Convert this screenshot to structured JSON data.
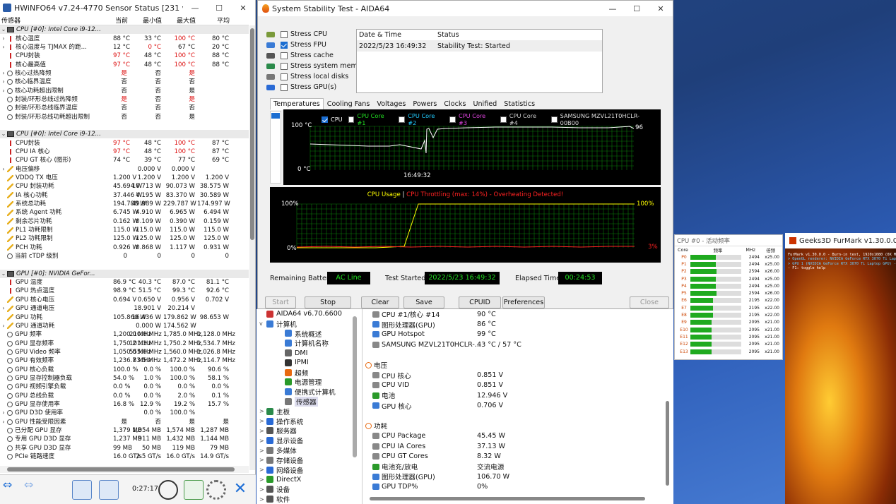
{
  "hwinfo": {
    "title": "HWiNFO64 v7.24-4770 Sensor Status [231 values hidd...",
    "columns": [
      "传感器",
      "当前",
      "最小值",
      "最大值",
      "平均"
    ],
    "rows": [
      {
        "k": "grp",
        "name": "CPU [#0]: Intel Core i9-12..."
      },
      {
        "k": "therm",
        "ex": ">",
        "name": "核心温度",
        "v": [
          "88 °C",
          "33 °C",
          "100 °C",
          "80 °C"
        ],
        "red": [
          2
        ]
      },
      {
        "k": "therm",
        "ex": ">",
        "name": "核心温度与 TJMAX 的距...",
        "v": [
          "12 °C",
          "0 °C",
          "67 °C",
          "20 °C"
        ],
        "red": [
          1
        ]
      },
      {
        "k": "therm",
        "name": "CPU封装",
        "v": [
          "97 °C",
          "48 °C",
          "100 °C",
          "88 °C"
        ],
        "red": [
          0,
          2
        ]
      },
      {
        "k": "therm",
        "name": "核心最高值",
        "v": [
          "97 °C",
          "48 °C",
          "100 °C",
          "88 °C"
        ],
        "red": [
          0,
          2
        ]
      },
      {
        "k": "circ",
        "ex": ">",
        "name": "核心过热降频",
        "v": [
          "是",
          "否",
          "是",
          ""
        ],
        "red": [
          0,
          2
        ]
      },
      {
        "k": "circ",
        "ex": ">",
        "name": "核心临界温度",
        "v": [
          "否",
          "否",
          "否",
          ""
        ]
      },
      {
        "k": "circ",
        "ex": ">",
        "name": "核心功耗超出限制",
        "v": [
          "否",
          "否",
          "是",
          ""
        ]
      },
      {
        "k": "circ",
        "name": "封装/环形总线过热降频",
        "v": [
          "是",
          "否",
          "是",
          ""
        ],
        "red": [
          0,
          2
        ]
      },
      {
        "k": "circ",
        "name": "封装/环形总线临界温度",
        "v": [
          "否",
          "否",
          "否",
          ""
        ]
      },
      {
        "k": "circ",
        "name": "封装/环形总线功耗超出限制",
        "v": [
          "否",
          "否",
          "是",
          ""
        ]
      },
      {
        "k": "blank",
        "name": ""
      },
      {
        "k": "grp",
        "name": "CPU [#0]: Intel Core i9-12..."
      },
      {
        "k": "therm",
        "name": "CPU封装",
        "v": [
          "97 °C",
          "48 °C",
          "100 °C",
          "87 °C"
        ],
        "red": [
          0,
          2
        ]
      },
      {
        "k": "therm",
        "name": "CPU IA 核心",
        "v": [
          "97 °C",
          "48 °C",
          "100 °C",
          "87 °C"
        ],
        "red": [
          0,
          2
        ]
      },
      {
        "k": "therm",
        "name": "CPU GT 核心 (图形)",
        "v": [
          "74 °C",
          "39 °C",
          "77 °C",
          "69 °C"
        ]
      },
      {
        "k": "bolt",
        "ex": ">",
        "name": "电压偏移",
        "v": [
          "",
          "0.000 V",
          "0.000 V",
          ""
        ]
      },
      {
        "k": "bolt",
        "name": "VDDQ TX 电压",
        "v": [
          "1.200 V",
          "1.200 V",
          "1.200 V",
          "1.200 V"
        ]
      },
      {
        "k": "bolt",
        "name": "CPU 封装功耗",
        "v": [
          "45.694 W",
          "10.713 W",
          "90.073 W",
          "38.575 W"
        ]
      },
      {
        "k": "bolt",
        "name": "IA 核心功耗",
        "v": [
          "37.446 W",
          "4.195 W",
          "83.370 W",
          "30.589 W"
        ]
      },
      {
        "k": "bolt",
        "name": "系统总功耗",
        "v": [
          "194.788 W",
          "49.989 W",
          "229.787 W",
          "174.997 W"
        ]
      },
      {
        "k": "bolt",
        "name": "系统 Agent 功耗",
        "v": [
          "6.745 W",
          "4.910 W",
          "6.965 W",
          "6.494 W"
        ]
      },
      {
        "k": "bolt",
        "name": "剩余芯片功耗",
        "v": [
          "0.162 W",
          "0.109 W",
          "0.390 W",
          "0.159 W"
        ]
      },
      {
        "k": "bolt",
        "name": "PL1 功耗限制",
        "v": [
          "115.0 W",
          "115.0 W",
          "115.0 W",
          "115.0 W"
        ]
      },
      {
        "k": "bolt",
        "name": "PL2 功耗限制",
        "v": [
          "125.0 W",
          "125.0 W",
          "125.0 W",
          "125.0 W"
        ]
      },
      {
        "k": "bolt",
        "name": "PCH 功耗",
        "v": [
          "0.926 W",
          "0.868 W",
          "1.117 W",
          "0.931 W"
        ]
      },
      {
        "k": "circ",
        "name": "当前 cTDP 级别",
        "v": [
          "0",
          "0",
          "0",
          "0"
        ]
      },
      {
        "k": "blank",
        "name": ""
      },
      {
        "k": "grp",
        "name": "GPU [#0]: NVIDIA GeFor..."
      },
      {
        "k": "therm",
        "name": "GPU 温度",
        "v": [
          "86.9 °C",
          "40.3 °C",
          "87.0 °C",
          "81.1 °C"
        ]
      },
      {
        "k": "therm",
        "name": "GPU 热点温度",
        "v": [
          "98.9 °C",
          "51.5 °C",
          "99.3 °C",
          "92.6 °C"
        ]
      },
      {
        "k": "bolt",
        "name": "GPU 核心电压",
        "v": [
          "0.694 V",
          "0.650 V",
          "0.956 V",
          "0.702 V"
        ]
      },
      {
        "k": "bolt",
        "ex": ">",
        "name": "GPU 通道电压",
        "v": [
          "",
          "18.901 V",
          "20.214 V",
          ""
        ]
      },
      {
        "k": "bolt",
        "name": "GPU 功耗",
        "v": [
          "105.860 W",
          "16.436 W",
          "179.862 W",
          "98.653 W"
        ]
      },
      {
        "k": "bolt",
        "ex": ">",
        "name": "GPU 通道功耗",
        "v": [
          "",
          "0.000 W",
          "174.562 W",
          ""
        ]
      },
      {
        "k": "circ",
        "name": "GPU 频率",
        "v": [
          "1,200.0 MHz",
          "210.0 MHz",
          "1,785.0 MHz",
          "1,128.0 MHz"
        ]
      },
      {
        "k": "circ",
        "name": "GPU 显存频率",
        "v": [
          "1,750.2 MHz",
          "101.3 MHz",
          "1,750.2 MHz",
          "1,534.7 MHz"
        ]
      },
      {
        "k": "circ",
        "name": "GPU Video 频率",
        "v": [
          "1,050.0 MHz",
          "555.0 MHz",
          "1,560.0 MHz",
          "1,026.8 MHz"
        ]
      },
      {
        "k": "circ",
        "name": "GPU 有效频率",
        "v": [
          "1,236.7 MHz",
          "83.5 MHz",
          "1,472.2 MHz",
          "1,114.7 MHz"
        ]
      },
      {
        "k": "circ",
        "name": "GPU 核心负载",
        "v": [
          "100.0 %",
          "0.0 %",
          "100.0 %",
          "90.6 %"
        ]
      },
      {
        "k": "circ",
        "name": "GPU 显存控制器负载",
        "v": [
          "54.0 %",
          "1.0 %",
          "100.0 %",
          "58.1 %"
        ]
      },
      {
        "k": "circ",
        "name": "GPU 视频引擎负载",
        "v": [
          "0.0 %",
          "0.0 %",
          "0.0 %",
          "0.0 %"
        ]
      },
      {
        "k": "circ",
        "name": "GPU 总线负载",
        "v": [
          "0.0 %",
          "0.0 %",
          "2.0 %",
          "0.1 %"
        ]
      },
      {
        "k": "circ",
        "name": "GPU 显存使用率",
        "v": [
          "16.8 %",
          "12.9 %",
          "19.2 %",
          "15.7 %"
        ]
      },
      {
        "k": "circ",
        "ex": ">",
        "name": "GPU D3D 使用率",
        "v": [
          "",
          "0.0 %",
          "100.0 %",
          ""
        ]
      },
      {
        "k": "circ",
        "ex": ">",
        "name": "GPU 性能受限因素",
        "v": [
          "是",
          "否",
          "是",
          "是"
        ]
      },
      {
        "k": "circ",
        "name": "已分配 GPU 显存",
        "v": [
          "1,379 MB",
          "1,054 MB",
          "1,574 MB",
          "1,287 MB"
        ]
      },
      {
        "k": "circ",
        "name": "专用 GPU D3D 显存",
        "v": [
          "1,237 MB",
          "911 MB",
          "1,432 MB",
          "1,144 MB"
        ]
      },
      {
        "k": "circ",
        "name": "共享 GPU D3D 显存",
        "v": [
          "99 MB",
          "50 MB",
          "119 MB",
          "79 MB"
        ]
      },
      {
        "k": "circ",
        "name": "PCIe 链路速度",
        "v": [
          "16.0 GT/s",
          "2.5 GT/s",
          "16.0 GT/s",
          "14.9 GT/s"
        ]
      }
    ],
    "timer": "0:27:17"
  },
  "stability": {
    "title": "System Stability Test - AIDA64",
    "checks": [
      {
        "label": "Stress CPU",
        "on": false
      },
      {
        "label": "Stress FPU",
        "on": true
      },
      {
        "label": "Stress cache",
        "on": false
      },
      {
        "label": "Stress system memory",
        "on": false
      },
      {
        "label": "Stress local disks",
        "on": false
      },
      {
        "label": "Stress GPU(s)",
        "on": false
      }
    ],
    "log_headers": [
      "Date & Time",
      "Status"
    ],
    "log_rows": [
      [
        "2022/5/23 16:49:32",
        "Stability Test: Started"
      ]
    ],
    "tabs": [
      "Temperatures",
      "Cooling Fans",
      "Voltages",
      "Powers",
      "Clocks",
      "Unified",
      "Statistics"
    ],
    "temp_legend": [
      {
        "label": "CPU",
        "color": "#ffffff",
        "on": true
      },
      {
        "label": "CPU Core #1",
        "color": "#22dd22",
        "on": false
      },
      {
        "label": "CPU Core #2",
        "color": "#22ccff",
        "on": false
      },
      {
        "label": "CPU Core #3",
        "color": "#dd44dd",
        "on": false
      },
      {
        "label": "CPU Core #4",
        "color": "#cccccc",
        "on": false
      },
      {
        "label": "SAMSUNG MZVL21T0HCLR-00B00",
        "color": "#dddddd",
        "on": false
      }
    ],
    "temp_top": "100 °C",
    "temp_bottom": "0 °C",
    "temp_time": "16:49:32",
    "temp_value": "96",
    "usage_title": "CPU Usage",
    "usage_sep": "|",
    "usage_throttle": "CPU Throttling (max: 14%) - Overheating Detected!",
    "usage_top": "100%",
    "usage_bottom": "0%",
    "usage_right_top": "100%",
    "usage_right_bottom": "3%",
    "remaining_battery_label": "Remaining Battery:",
    "remaining_battery": "AC Line",
    "test_started_label": "Test Started:",
    "test_started": "2022/5/23 16:49:32",
    "elapsed_label": "Elapsed Time:",
    "elapsed": "00:24:53",
    "buttons": {
      "start": "Start",
      "stop": "Stop",
      "clear": "Clear",
      "save": "Save",
      "cpuid": "CPUID",
      "preferences": "Preferences",
      "close": "Close"
    }
  },
  "aida": {
    "tree": [
      {
        "label": "AIDA64 v6.70.6600",
        "lvl": 0,
        "c": "#c33"
      },
      {
        "label": "计算机",
        "lvl": 0,
        "ex": "v",
        "c": "#3a7bd5"
      },
      {
        "label": "系统概述",
        "lvl": 1,
        "c": "#3a7bd5"
      },
      {
        "label": "计算机名称",
        "lvl": 1,
        "c": "#3a7bd5"
      },
      {
        "label": "DMI",
        "lvl": 1,
        "c": "#666"
      },
      {
        "label": "IPMI",
        "lvl": 1,
        "c": "#333"
      },
      {
        "label": "超频",
        "lvl": 1,
        "c": "#e86a10"
      },
      {
        "label": "电源管理",
        "lvl": 1,
        "c": "#2a9a2a"
      },
      {
        "label": "便携式计算机",
        "lvl": 1,
        "c": "#3a7bd5"
      },
      {
        "label": "传感器",
        "lvl": 1,
        "c": "#777",
        "sel": true
      },
      {
        "label": "主板",
        "lvl": 0,
        "ex": ">",
        "c": "#2a8a4a"
      },
      {
        "label": "操作系统",
        "lvl": 0,
        "ex": ">",
        "c": "#2a6ad5"
      },
      {
        "label": "服务器",
        "lvl": 0,
        "ex": ">",
        "c": "#555"
      },
      {
        "label": "显示设备",
        "lvl": 0,
        "ex": ">",
        "c": "#2a6ad5"
      },
      {
        "label": "多媒体",
        "lvl": 0,
        "ex": ">",
        "c": "#777"
      },
      {
        "label": "存储设备",
        "lvl": 0,
        "ex": ">",
        "c": "#777"
      },
      {
        "label": "网络设备",
        "lvl": 0,
        "ex": ">",
        "c": "#2a6ad5"
      },
      {
        "label": "DirectX",
        "lvl": 0,
        "ex": ">",
        "c": "#2a9a2a"
      },
      {
        "label": "设备",
        "lvl": 0,
        "ex": ">",
        "c": "#555"
      },
      {
        "label": "软件",
        "lvl": 0,
        "ex": ">",
        "c": "#555"
      }
    ],
    "list": [
      {
        "name": "CPU #1/核心 #14",
        "val": "90 °C",
        "c": "#888"
      },
      {
        "name": "图形处理器(GPU)",
        "val": "86 °C",
        "c": "#3a7bd5"
      },
      {
        "name": "GPU Hotspot",
        "val": "99 °C",
        "c": "#3a7bd5"
      },
      {
        "name": "SAMSUNG MZVL21T0HCLR-...",
        "val": "43 °C / 57 °C",
        "c": "#888"
      },
      {
        "name": "",
        "val": ""
      },
      {
        "name": "电压",
        "val": "",
        "sec": true
      },
      {
        "name": "CPU 核心",
        "val": "0.851 V",
        "c": "#888"
      },
      {
        "name": "CPU VID",
        "val": "0.851 V",
        "c": "#888"
      },
      {
        "name": "电池",
        "val": "12.946 V",
        "c": "#2a9a2a"
      },
      {
        "name": "GPU 核心",
        "val": "0.706 V",
        "c": "#3a7bd5"
      },
      {
        "name": "",
        "val": ""
      },
      {
        "name": "功耗",
        "val": "",
        "sec": true
      },
      {
        "name": "CPU Package",
        "val": "45.45 W",
        "c": "#888"
      },
      {
        "name": "CPU IA Cores",
        "val": "37.13 W",
        "c": "#888"
      },
      {
        "name": "CPU GT Cores",
        "val": "8.32 W",
        "c": "#888"
      },
      {
        "name": "电池充/放电",
        "val": "交流电源",
        "c": "#2a9a2a"
      },
      {
        "name": "图形处理器(GPU)",
        "val": "106.70 W",
        "c": "#3a7bd5"
      },
      {
        "name": "GPU TDP%",
        "val": "0%",
        "c": "#3a7bd5"
      }
    ]
  },
  "cpuwidget": {
    "title": "CPU #0 - 活动频率",
    "headers": [
      "Core",
      "频率",
      "MHz",
      "倍频"
    ],
    "cores": [
      {
        "n": "P0",
        "mhz": "2494",
        "mul": "x25.00",
        "f": 0.5
      },
      {
        "n": "P1",
        "mhz": "2494",
        "mul": "x25.00",
        "f": 0.5
      },
      {
        "n": "P2",
        "mhz": "2594",
        "mul": "x26.00",
        "f": 0.52
      },
      {
        "n": "P3",
        "mhz": "2494",
        "mul": "x25.00",
        "f": 0.5
      },
      {
        "n": "P4",
        "mhz": "2494",
        "mul": "x25.00",
        "f": 0.5
      },
      {
        "n": "P5",
        "mhz": "2594",
        "mul": "x26.00",
        "f": 0.52
      },
      {
        "n": "E6",
        "mhz": "2195",
        "mul": "x22.00",
        "f": 0.44
      },
      {
        "n": "E7",
        "mhz": "2195",
        "mul": "x22.00",
        "f": 0.44
      },
      {
        "n": "E8",
        "mhz": "2195",
        "mul": "x22.00",
        "f": 0.44
      },
      {
        "n": "E9",
        "mhz": "2095",
        "mul": "x21.00",
        "f": 0.42
      },
      {
        "n": "E10",
        "mhz": "2095",
        "mul": "x21.00",
        "f": 0.42
      },
      {
        "n": "E11",
        "mhz": "2095",
        "mul": "x21.00",
        "f": 0.42
      },
      {
        "n": "E12",
        "mhz": "2095",
        "mul": "x21.00",
        "f": 0.42
      },
      {
        "n": "E13",
        "mhz": "2095",
        "mul": "x21.00",
        "f": 0.42
      }
    ]
  },
  "furmark": {
    "title": "Geeks3D FurMark v1.30.0.0 - 27",
    "overlay": [
      "FurMark v1.30.0.0 - Burn-in test, 1920x1080 (0X MSAA)",
      "> OpenGL renderer: NVIDIA GeForce RTX 3070 Ti Laptop",
      "> GPU 1 (NVIDIA GeForce RTX 3070 Ti Laptop GPU) - core",
      "- F1: toggle help"
    ]
  }
}
